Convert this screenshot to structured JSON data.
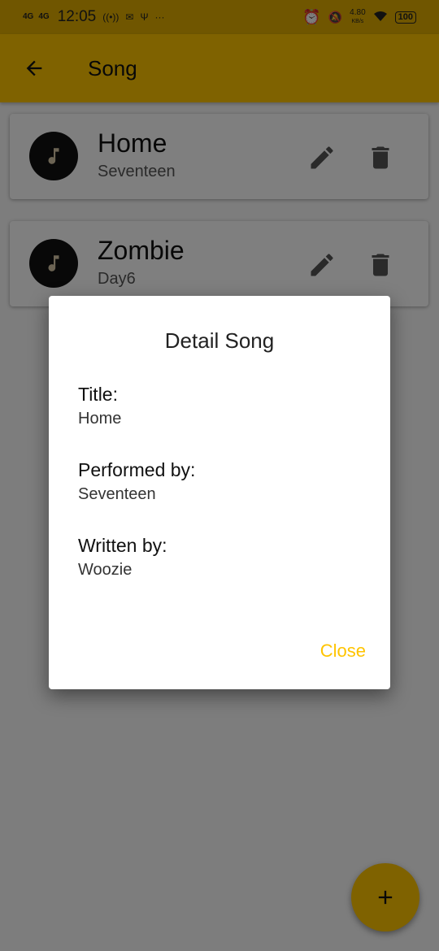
{
  "status_bar": {
    "network1": "4G",
    "network2": "4G",
    "time": "12:05",
    "net_speed_value": "4.80",
    "net_speed_unit": "KB/s",
    "battery": "100"
  },
  "app_bar": {
    "title": "Song",
    "back_icon": "arrow-left-icon"
  },
  "songs": [
    {
      "title": "Home",
      "artist": "Seventeen"
    },
    {
      "title": "Zombie",
      "artist": "Day6"
    }
  ],
  "dialog": {
    "title": "Detail Song",
    "title_label": "Title:",
    "title_value": "Home",
    "performed_label": "Performed by:",
    "performed_value": "Seventeen",
    "written_label": "Written by:",
    "written_value": "Woozie",
    "close_label": "Close"
  },
  "colors": {
    "accent": "#ffc400",
    "status_bar": "#e0ad00"
  },
  "fab_icon": "plus-icon"
}
